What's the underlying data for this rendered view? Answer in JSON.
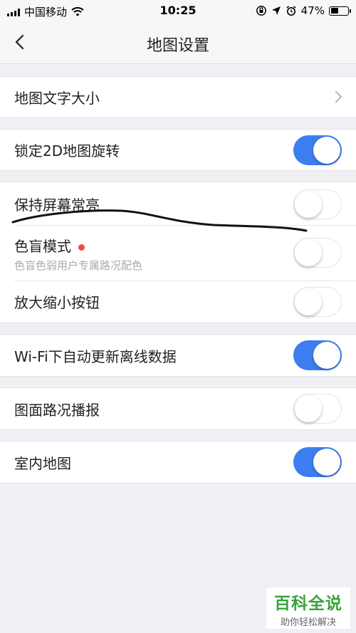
{
  "status": {
    "carrier": "中国移动",
    "time": "10:25",
    "battery_text": "47%",
    "battery_level": 0.47
  },
  "nav": {
    "title": "地图设置"
  },
  "settings": {
    "font_size": {
      "label": "地图文字大小"
    },
    "lock_2d": {
      "label": "锁定2D地图旋转",
      "enabled": true
    },
    "keep_screen_on": {
      "label": "保持屏幕常亮",
      "enabled": false
    },
    "colorblind_mode": {
      "label": "色盲模式",
      "subtitle": "色盲色弱用户专属路况配色",
      "enabled": false
    },
    "zoom_buttons": {
      "label": "放大缩小按钮",
      "enabled": false
    },
    "wifi_offline_update": {
      "label": "Wi-Fi下自动更新离线数据",
      "enabled": true
    },
    "traffic_broadcast": {
      "label": "图面路况播报",
      "enabled": false
    },
    "indoor_map": {
      "label": "室内地图",
      "enabled": true
    }
  },
  "colors": {
    "toggle_on": "#3c7df0",
    "badge_dot": "#f04a3f",
    "watermark_green": "#3aa33a"
  },
  "watermark": {
    "main": "百科全说",
    "sub": "助你轻松解决"
  }
}
